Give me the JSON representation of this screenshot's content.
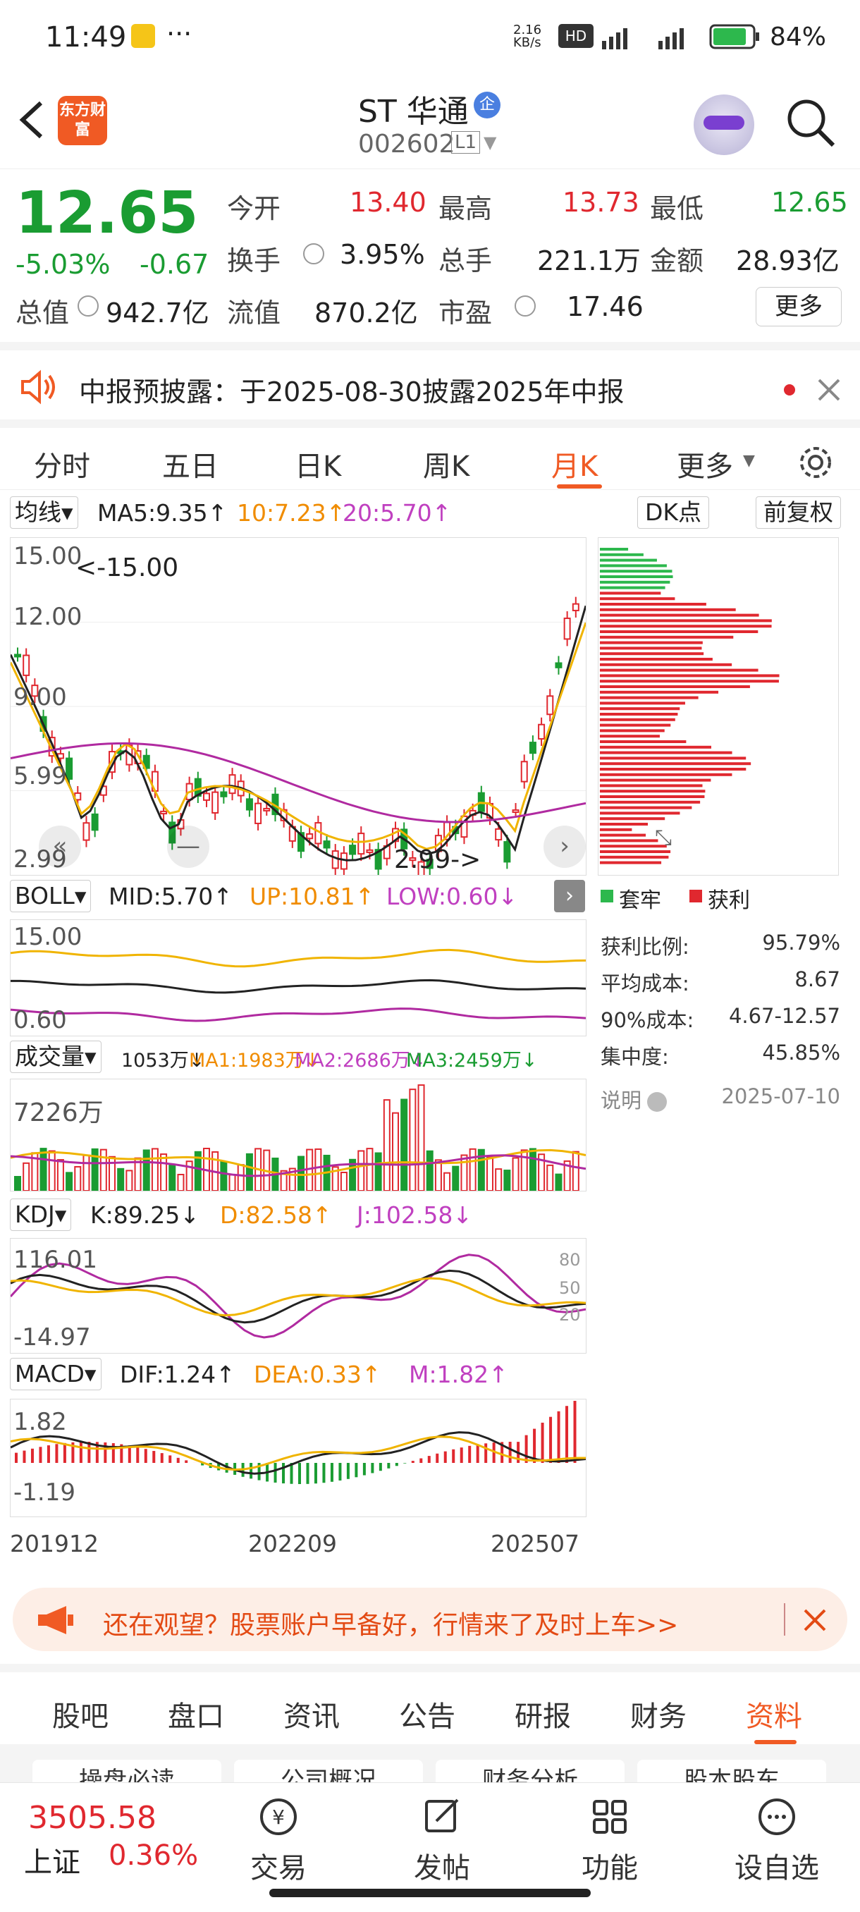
{
  "status": {
    "time": "11:49",
    "speed": "2.16 KB/s",
    "battery": "84%"
  },
  "header": {
    "logo": "东方财富",
    "title": "ST 华通",
    "badge": "企",
    "code": "002602",
    "level": "L1"
  },
  "quote": {
    "price": "12.65",
    "pct": "-5.03%",
    "chg": "-0.67",
    "labels": {
      "open": "今开",
      "high": "最高",
      "low": "最低",
      "turnover": "换手",
      "vol": "总手",
      "amount": "金额",
      "mktcap": "总值",
      "float": "流值",
      "pe": "市盈"
    },
    "open": "13.40",
    "high": "13.73",
    "low": "12.65",
    "turnover": "3.95%",
    "vol": "221.1万",
    "amount": "28.93亿",
    "mktcap": "942.7亿",
    "float": "870.2亿",
    "pe": "17.46",
    "more": "更多"
  },
  "notice": {
    "text": "中报预披露：于2025-08-30披露2025年中报"
  },
  "tabs": [
    "分时",
    "五日",
    "日K",
    "周K",
    "月K",
    "更多"
  ],
  "ma": {
    "selector": "均线",
    "ma5": "MA5:9.35↑",
    "ma10": "10:7.23↑",
    "ma20": "20:5.70↑",
    "dk": "DK点",
    "fq": "前复权"
  },
  "kline": {
    "ytop": "15.00",
    "y2": "12.00",
    "y3": "9.00",
    "y4": "5.99",
    "ybot": "2.99",
    "hi_note": "<-15.00",
    "lo_note": "2.99->"
  },
  "chip": {
    "legend_trap": "套牢",
    "legend_profit": "获利",
    "rows": [
      {
        "k": "获利比例:",
        "v": "95.79%"
      },
      {
        "k": "平均成本:",
        "v": "8.67"
      },
      {
        "k": "90%成本:",
        "v": "4.67-12.57"
      },
      {
        "k": "集中度:",
        "v": "45.85%"
      }
    ],
    "note": "说明",
    "date": "2025-07-10"
  },
  "boll": {
    "selector": "BOLL",
    "mid": "MID:5.70↑",
    "up": "UP:10.81↑",
    "low": "LOW:0.60↓",
    "ytop": "15.00",
    "ybot": "0.60"
  },
  "volume": {
    "selector": "成交量",
    "cur": "1053万↓",
    "ma1": "MA1:1983万↓",
    "ma2": "MA2:2686万↓",
    "ma3": "MA3:2459万↓",
    "ytop": "7226万"
  },
  "kdj": {
    "selector": "KDJ",
    "k": "K:89.25↓",
    "d": "D:82.58↑",
    "j": "J:102.58↓",
    "ytop": "116.01",
    "ybot": "-14.97",
    "l80": "80",
    "l50": "50",
    "l20": "20"
  },
  "macd": {
    "selector": "MACD",
    "dif": "DIF:1.24↑",
    "dea": "DEA:0.33↑",
    "m": "M:1.82↑",
    "ytop": "1.82",
    "ybot": "-1.19"
  },
  "xaxis": [
    "201912",
    "202209",
    "202507"
  ],
  "ad": {
    "text": "还在观望？股票账户早备好，行情来了及时上车>>"
  },
  "bottom_tabs": [
    "股吧",
    "盘口",
    "资讯",
    "公告",
    "研报",
    "财务",
    "资料"
  ],
  "subtabs": [
    "操盘必读",
    "公司概况",
    "财务分析",
    "股本股东"
  ],
  "footer": {
    "index_value": "3505.58",
    "index_name": "上证",
    "index_pct": "0.36%",
    "items": [
      "交易",
      "发帖",
      "功能",
      "设自选"
    ]
  }
}
